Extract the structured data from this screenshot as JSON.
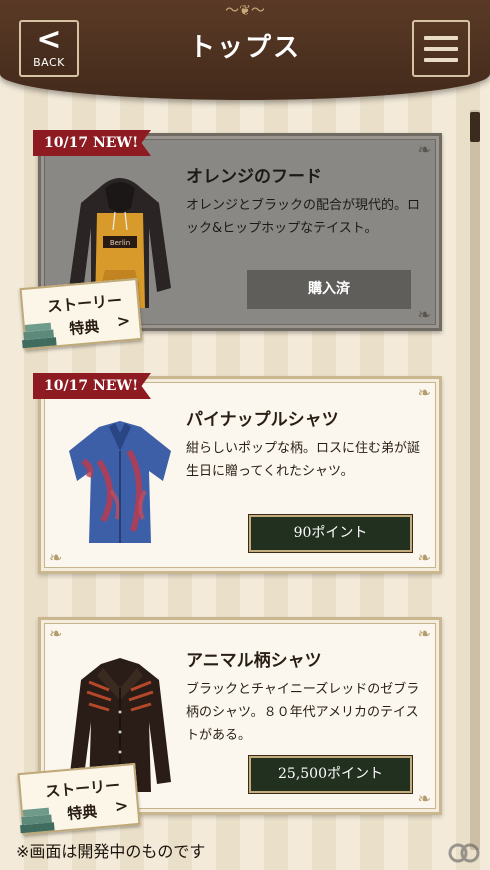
{
  "header": {
    "back_label": "BACK",
    "title": "トップス",
    "back_icon": "chevron-left-icon",
    "menu_icon": "hamburger-menu-icon"
  },
  "items": [
    {
      "ribbon": "10/17 NEW!",
      "name": "オレンジのフード",
      "desc": "オレンジとブラックの配合が現代的。ロック&ヒップホップなテイスト。",
      "button": "購入済",
      "owned": true,
      "story_badge": {
        "line1": "ストーリー",
        "line2": "特典",
        "arrow": ">"
      }
    },
    {
      "ribbon": "10/17 NEW!",
      "name": "パイナップルシャツ",
      "desc": "紺らしいポップな柄。ロスに住む弟が誕生日に贈ってくれたシャツ。",
      "button": "90ポイント",
      "owned": false
    },
    {
      "name": "アニマル柄シャツ",
      "desc": "ブラックとチャイニーズレッドのゼブラ柄のシャツ。８０年代アメリカのテイストがある。",
      "button": "25,500ポイント",
      "owned": false,
      "story_badge": {
        "line1": "ストーリー",
        "line2": "特典",
        "arrow": ">"
      }
    }
  ],
  "footnote": "※画面は開発中のものです",
  "colors": {
    "header": "#4d3220",
    "ribbon": "#8e1b22",
    "price_button": "#22301f",
    "purchased_button": "#5f5e5b"
  }
}
